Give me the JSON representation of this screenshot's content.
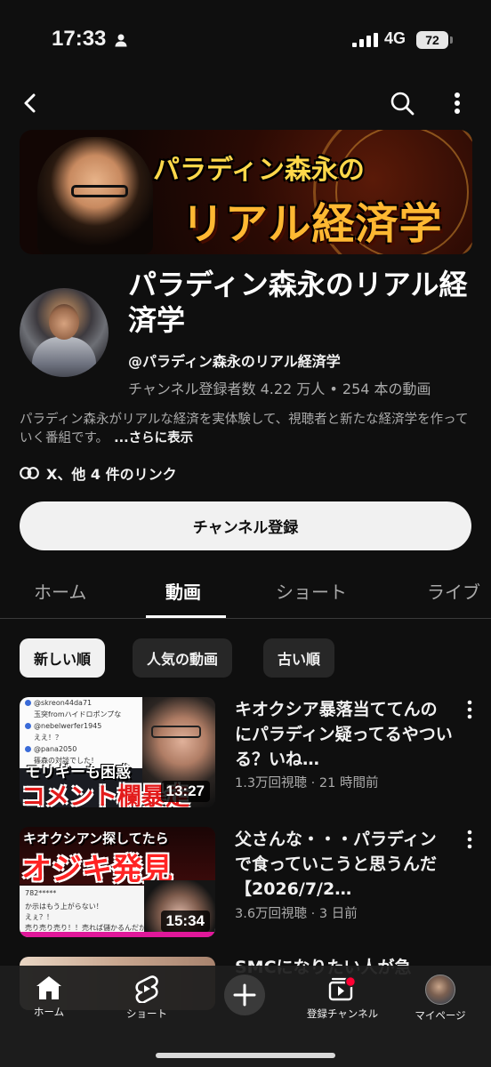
{
  "status": {
    "time": "17:33",
    "network": "4G",
    "battery": "72"
  },
  "banner": {
    "line1": "パラディン森永の",
    "line2": "リアル経済学"
  },
  "channel": {
    "title": "パラディン森永のリアル経済学",
    "handle": "@パラディン森永のリアル経済学",
    "stats": "チャンネル登録者数 4.22 万人 • 254 本の動画",
    "description": "パラディン森永がリアルな経済を実体験して、視聴者と新たな経済学を作っていく番組です。",
    "more": "...さらに表示",
    "links": "X、他 4 件のリンク",
    "subscribe": "チャンネル登録"
  },
  "tabs": [
    {
      "label": "ホーム"
    },
    {
      "label": "動画"
    },
    {
      "label": "ショート"
    },
    {
      "label": "ライブ"
    }
  ],
  "chips": [
    {
      "label": "新しい順"
    },
    {
      "label": "人気の動画"
    },
    {
      "label": "古い順"
    }
  ],
  "videos": [
    {
      "title": "キオクシア暴落当ててんのにパラディン疑ってるやついる？いね…",
      "meta": "1.3万回視聴 · 21 時間前",
      "duration": "13:27",
      "thumb_caption1": "モリギーも困惑",
      "thumb_caption2": "コメント欄暴走",
      "thumb_comments": [
        "@skreon44da71",
        "玉突fromハイドロポンプな",
        "@nebelwerfer1945",
        "ええ！？",
        "@pana2050",
        "篠森の対談でした！"
      ]
    },
    {
      "title": "父さんな・・・パラディンで食っていこうと思うんだ【2026/7/2…",
      "meta": "3.6万回視聴 · 3 日前",
      "duration": "15:34",
      "thumb_caption1": "キオクシアン探してたら",
      "thumb_caption2": "オジキ発見",
      "thumb_comments": [
        "782*****",
        "か示はもう上がらない！",
        "えぇ？！",
        "売り売り売り！！売れば儲かるんだから！"
      ]
    },
    {
      "title": "SMCになりたい人が急",
      "meta": ""
    }
  ],
  "bottom_nav": [
    {
      "label": "ホーム"
    },
    {
      "label": "ショート"
    },
    {
      "label": "登録チャンネル"
    },
    {
      "label": "マイページ"
    }
  ]
}
